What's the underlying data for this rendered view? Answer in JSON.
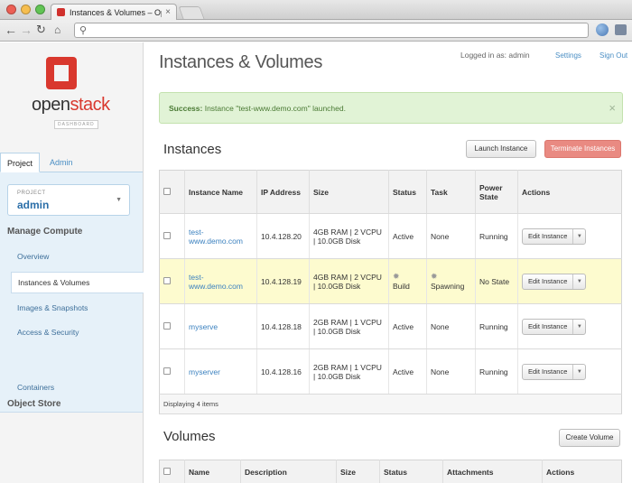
{
  "browser": {
    "tab_title": "Instances & Volumes – Open",
    "tab_close": "×",
    "colors": {
      "close": "#ec5f55",
      "minimize": "#f6be4f",
      "maximize": "#61c454"
    }
  },
  "brand": {
    "logo_open": "open",
    "logo_stack": "stack",
    "logo_sub": "DASHBOARD",
    "accent": "#d9382e"
  },
  "sidebar": {
    "tabs": [
      "Project",
      "Admin"
    ],
    "project_label": "PROJECT",
    "project_value": "admin",
    "manage_compute": "Manage Compute",
    "items": [
      "Overview",
      "Instances & Volumes",
      "Images & Snapshots",
      "Access & Security"
    ],
    "object_store": "Object Store",
    "containers": "Containers"
  },
  "header": {
    "title": "Instances & Volumes",
    "logged_in": "Logged in as: admin",
    "settings": "Settings",
    "sign_out": "Sign Out"
  },
  "alert": {
    "strong": "Success:",
    "message": " Instance \"test-www.demo.com\" launched.",
    "close": "×"
  },
  "instances": {
    "title": "Instances",
    "launch": "Launch Instance",
    "terminate": "Terminate Instances",
    "columns": [
      "Instance Name",
      "IP Address",
      "Size",
      "Status",
      "Task",
      "Power State",
      "Actions"
    ],
    "rows": [
      {
        "name": "test-www.demo.com",
        "ip": "10.4.128.20",
        "size": "4GB RAM | 2 VCPU | 10.0GB Disk",
        "status": "Active",
        "task": "None",
        "power": "Running",
        "action": "Edit Instance"
      },
      {
        "name": "test-www.demo.com",
        "ip": "10.4.128.19",
        "size": "4GB RAM | 2 VCPU | 10.0GB Disk",
        "status": "Build",
        "task": "Spawning",
        "power": "No State",
        "action": "Edit Instance"
      },
      {
        "name": "myserve",
        "ip": "10.4.128.18",
        "size": "2GB RAM | 1 VCPU | 10.0GB Disk",
        "status": "Active",
        "task": "None",
        "power": "Running",
        "action": "Edit Instance"
      },
      {
        "name": "myserver",
        "ip": "10.4.128.16",
        "size": "2GB RAM | 1 VCPU | 10.0GB Disk",
        "status": "Active",
        "task": "None",
        "power": "Running",
        "action": "Edit Instance"
      }
    ],
    "footer": "Displaying 4 items",
    "highlight": "#fdfbcf"
  },
  "volumes": {
    "title": "Volumes",
    "create": "Create Volume",
    "columns": [
      "Name",
      "Description",
      "Size",
      "Status",
      "Attachments",
      "Actions"
    ]
  }
}
